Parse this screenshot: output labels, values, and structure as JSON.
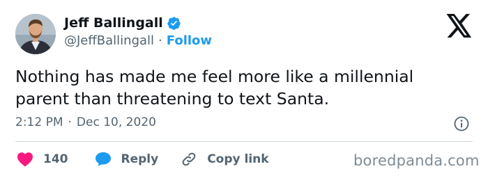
{
  "author": {
    "display_name": "Jeff Ballingall",
    "handle": "@JeffBallingall",
    "separator": "·",
    "follow_label": "Follow",
    "verified_icon": "verified-badge-icon",
    "avatar_icon": "avatar"
  },
  "platform_logo": "x-logo-icon",
  "tweet": {
    "text_line1": "Nothing has made me feel more like a millennial",
    "text_line2": "parent than threatening to text Santa."
  },
  "meta": {
    "time": "2:12 PM",
    "separator": "·",
    "date": "Dec 10, 2020",
    "info_icon": "info-icon"
  },
  "actions": {
    "like_count": "140",
    "reply_label": "Reply",
    "copy_link_label": "Copy link"
  },
  "watermark": "boredpanda.com",
  "colors": {
    "accent": "#1d9bf0",
    "heart": "#f91880",
    "text_primary": "#0f1419",
    "text_secondary": "#536471"
  }
}
